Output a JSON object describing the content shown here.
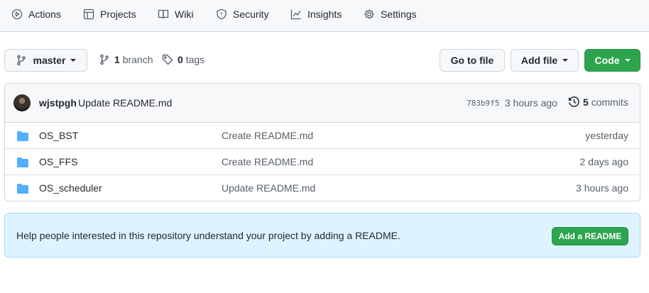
{
  "nav": {
    "items": [
      {
        "label": "Actions",
        "icon": "play-icon"
      },
      {
        "label": "Projects",
        "icon": "table-icon"
      },
      {
        "label": "Wiki",
        "icon": "book-icon"
      },
      {
        "label": "Security",
        "icon": "shield-icon"
      },
      {
        "label": "Insights",
        "icon": "graph-icon"
      },
      {
        "label": "Settings",
        "icon": "gear-icon"
      }
    ]
  },
  "toolbar": {
    "branch_selector": "master",
    "branch_count": "1",
    "branch_label": "branch",
    "tag_count": "0",
    "tag_label": "tags",
    "go_to_file": "Go to file",
    "add_file": "Add file",
    "code": "Code"
  },
  "latest_commit": {
    "author": "wjstpgh",
    "message": "Update README.md",
    "sha": "783b9f5",
    "time": "3 hours ago",
    "commit_count": "5",
    "commit_label": "commits"
  },
  "files": [
    {
      "name": "OS_BST",
      "message": "Create README.md",
      "age": "yesterday"
    },
    {
      "name": "OS_FFS",
      "message": "Create README.md",
      "age": "2 days ago"
    },
    {
      "name": "OS_scheduler",
      "message": "Update README.md",
      "age": "3 hours ago"
    }
  ],
  "readme_banner": {
    "text": "Help people interested in this repository understand your project by adding a README.",
    "button": "Add a README"
  },
  "colors": {
    "accent_green": "#2da44e",
    "folder_blue": "#54aeff",
    "banner_bg": "#ddf4ff"
  }
}
